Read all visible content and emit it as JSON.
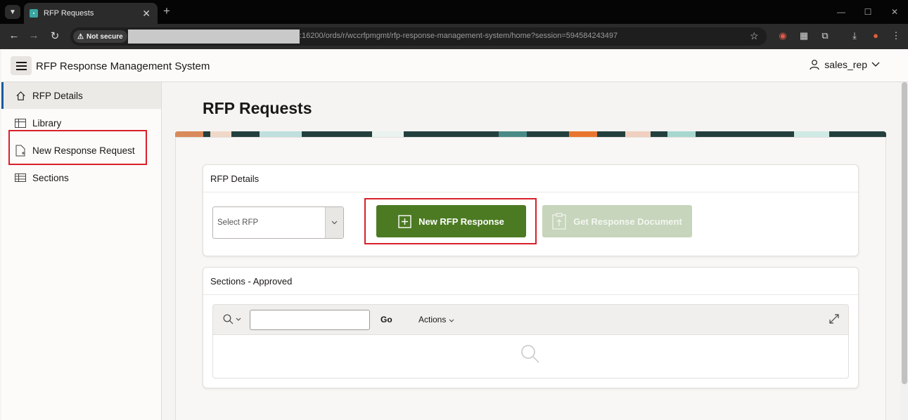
{
  "browser": {
    "tab_title": "RFP Requests",
    "new_tab_symbol": "+",
    "security_label": "Not secure",
    "url_visible": ":16200/ords/r/wccrfpmgmt/rfp-response-management-system/home?session=594584243497"
  },
  "app": {
    "title": "RFP Response Management System",
    "user": "sales_rep"
  },
  "sidebar": {
    "items": [
      {
        "label": "RFP Details",
        "icon": "home-icon",
        "active": true
      },
      {
        "label": "Library",
        "icon": "grid-icon",
        "active": false
      },
      {
        "label": "New Response Request",
        "icon": "file-add-icon",
        "active": false
      },
      {
        "label": "Sections",
        "icon": "table-icon",
        "active": false
      }
    ]
  },
  "page": {
    "title": "RFP Requests"
  },
  "rfp_details": {
    "title": "RFP Details",
    "select_placeholder": "Select RFP",
    "new_button": "New RFP Response",
    "get_doc_button": "Get Response Document"
  },
  "sections": {
    "title": "Sections - Approved",
    "go": "Go",
    "actions": "Actions"
  },
  "colors": {
    "primary_button": "#4c7a22",
    "disabled_button": "#c6d5bb",
    "highlight": "#d9202a",
    "active_nav_border": "#1a5a9c"
  }
}
